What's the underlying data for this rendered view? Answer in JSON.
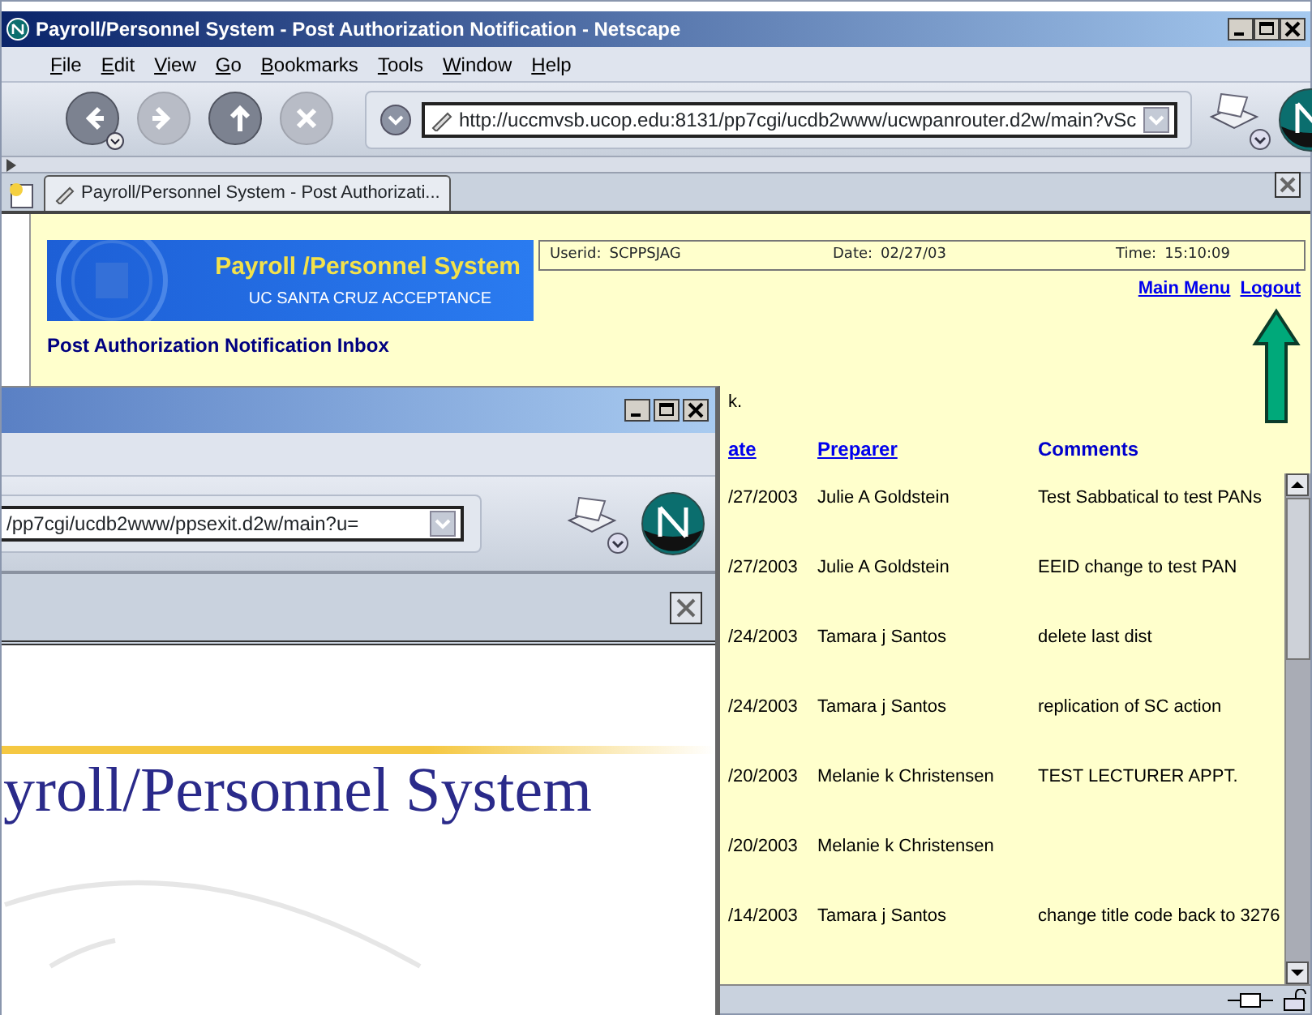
{
  "main_window": {
    "title": "Payroll/Personnel System - Post Authorization Notification - Netscape",
    "menu": [
      "File",
      "Edit",
      "View",
      "Go",
      "Bookmarks",
      "Tools",
      "Window",
      "Help"
    ],
    "nav_buttons": [
      {
        "kind": "back",
        "disabled": false
      },
      {
        "kind": "forward",
        "disabled": true
      },
      {
        "kind": "reload",
        "disabled": false
      },
      {
        "kind": "stop",
        "disabled": true
      }
    ],
    "url": "http://uccmvsb.ucop.edu:8131/pp7cgi/ucdb2www/ucwpanrouter.d2w/main?vSc",
    "tabs": [
      {
        "label": "Payroll/Personnel System - Post Authorizati...",
        "selected": true
      }
    ]
  },
  "page": {
    "banner": {
      "title": "Payroll /Personnel System",
      "subtitle": "UC SANTA CRUZ ACCEPTANCE"
    },
    "info": [
      {
        "label": "Userid:",
        "value": "SCPPSJAG"
      },
      {
        "label": "Date:",
        "value": "02/27/03"
      },
      {
        "label": "Time:",
        "value": "15:10:09"
      }
    ],
    "links": [
      "Main Menu",
      "Logout"
    ],
    "heading": "Post Authorization Notification Inbox",
    "partial_text": "k.",
    "columns": [
      {
        "label": "ate",
        "link": true
      },
      {
        "label": "Preparer",
        "link": true
      },
      {
        "label": "Comments",
        "link": false
      }
    ],
    "rows": [
      {
        "date": "/27/2003",
        "preparer": "Julie A Goldstein",
        "comment": "Test Sabbatical to test PANs"
      },
      {
        "date": "/27/2003",
        "preparer": "Julie A Goldstein",
        "comment": "EEID change to test PAN"
      },
      {
        "date": "/24/2003",
        "preparer": "Tamara j Santos",
        "comment": "delete last dist"
      },
      {
        "date": "/24/2003",
        "preparer": "Tamara j Santos",
        "comment": "replication of SC action"
      },
      {
        "date": "/20/2003",
        "preparer": "Melanie k Christensen",
        "comment": "TEST LECTURER APPT."
      },
      {
        "date": "/20/2003",
        "preparer": "Melanie k Christensen"
      },
      {
        "date": "/14/2003",
        "preparer": "Tamara j Santos",
        "comment": "change title code back to 3276"
      }
    ]
  },
  "exit_window": {
    "url": "/pp7cgi/ucdb2www/ppsexit.d2w/main?u=",
    "page_title": "yroll/Personnel System"
  }
}
